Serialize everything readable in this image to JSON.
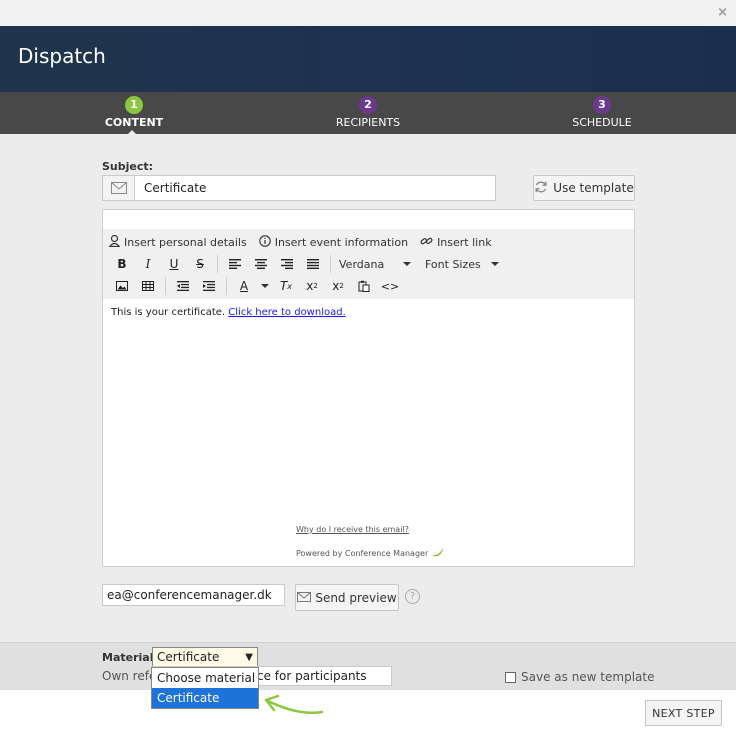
{
  "window": {
    "close_label": "×"
  },
  "header": {
    "title": "Dispatch"
  },
  "steps": [
    {
      "number": "1",
      "label": "CONTENT",
      "color": "#8dc63f",
      "active": true
    },
    {
      "number": "2",
      "label": "RECIPIENTS",
      "color": "#6b3a8f",
      "active": false
    },
    {
      "number": "3",
      "label": "SCHEDULE",
      "color": "#6b3a8f",
      "active": false
    }
  ],
  "subject": {
    "label": "Subject:",
    "value": "Certificate",
    "icon": "envelope-icon"
  },
  "use_template": {
    "label": "Use template",
    "icon": "refresh-icon"
  },
  "editor": {
    "insert_personal": "Insert personal details",
    "insert_event": "Insert event information",
    "insert_link": "Insert link",
    "font_family": "Verdana",
    "font_size": "Font Sizes",
    "body_text": "This is your certificate.",
    "body_link": "Click here to download.",
    "why_text": "Why do I receive this email?",
    "powered_text": "Powered by Conference Manager"
  },
  "preview": {
    "email_value": "ea@conferencemanager.dk",
    "send_label": "Send preview",
    "help": "?"
  },
  "material": {
    "label": "Material:",
    "selected": "Certificate",
    "options": [
      "Choose material",
      "Certificate"
    ],
    "highlighted": "Certificate"
  },
  "own_reference": {
    "label": "Own refe",
    "value_visible": "ce for participants"
  },
  "save_template": {
    "label": "Save as new template",
    "checked": false
  },
  "next_step": {
    "label": "NEXT STEP"
  },
  "colors": {
    "header_bg": "#1d3252",
    "steps_bg": "#484848",
    "accent_green": "#8dc63f",
    "accent_purple": "#6b3a8f",
    "highlight_blue": "#1e73d9"
  }
}
